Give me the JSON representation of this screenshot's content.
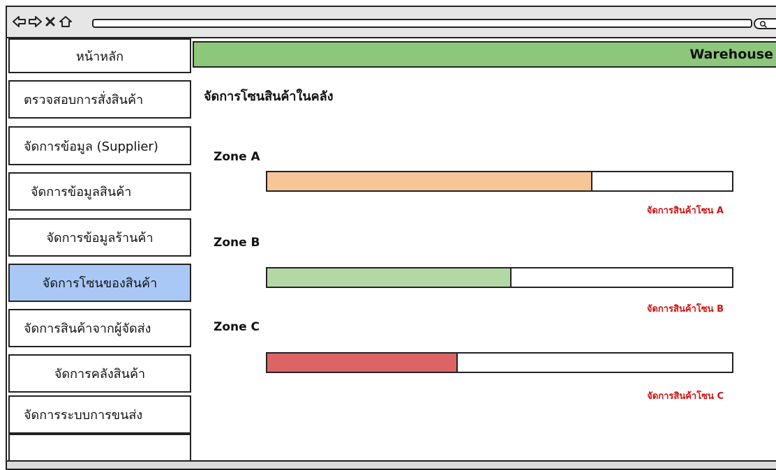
{
  "browser": {
    "icons": [
      "back-arrow-icon",
      "forward-arrow-icon",
      "close-icon",
      "home-icon",
      "search-icon"
    ]
  },
  "sidebar": {
    "items": [
      {
        "label": "หน้าหลัก"
      },
      {
        "label": "ตรวจสอบการสั่งสินค้า"
      },
      {
        "label": "จัดการข้อมูล (Supplier)"
      },
      {
        "label": "จัดการข้อมูลสินค้า"
      },
      {
        "label": "จัดการข้อมูลร้านค้า"
      },
      {
        "label": "จัดการโซนของสินค้า",
        "active": true
      },
      {
        "label": "จัดการสินค้าจากผู้จัดส่ง"
      },
      {
        "label": "จัดการคลังสินค้า"
      },
      {
        "label": "จัดการระบบการขนส่ง"
      }
    ]
  },
  "header": {
    "title": "Warehouse"
  },
  "main": {
    "title": "จัดการโซนสินค้าในคลัง",
    "zones": [
      {
        "label": "Zone A",
        "fill_fraction": 0.7,
        "color": "#f7c596",
        "link": "จัดการสินค้าโซน A"
      },
      {
        "label": "Zone B",
        "fill_fraction": 0.525,
        "color": "#b2d9a3",
        "link": "จัดการสินค้าโซน B"
      },
      {
        "label": "Zone C",
        "fill_fraction": 0.41,
        "color": "#dd6464",
        "link": "จัดการสินค้าโซน C"
      }
    ]
  },
  "colors": {
    "header_bg": "#8cc77c",
    "active_item_bg": "#a9c8f5",
    "link_red": "#d11111"
  }
}
